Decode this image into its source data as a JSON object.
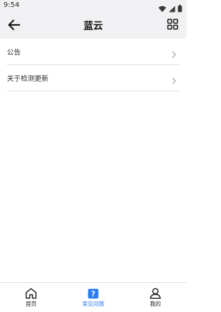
{
  "status_bar": {
    "time": "9:54"
  },
  "header": {
    "title": "蓝云"
  },
  "menu": {
    "items": [
      {
        "label": "公告"
      },
      {
        "label": "关于检测更新"
      }
    ]
  },
  "bottom_nav": {
    "active_color": "#2b7cf2",
    "items": [
      {
        "label": "首页",
        "icon": "home-icon",
        "active": false
      },
      {
        "label": "常见问题",
        "icon": "question-icon",
        "active": true
      },
      {
        "label": "我的",
        "icon": "user-icon",
        "active": false
      }
    ]
  }
}
